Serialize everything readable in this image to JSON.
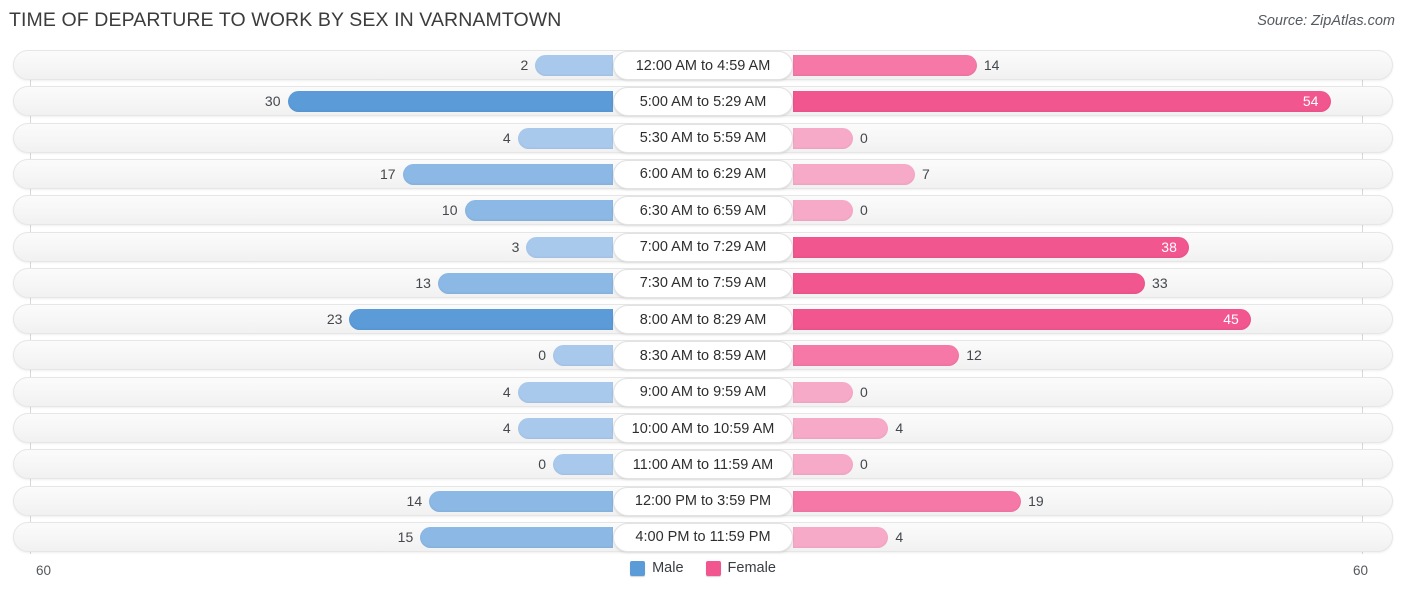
{
  "header": {
    "title": "TIME OF DEPARTURE TO WORK BY SEX IN VARNAMTOWN",
    "source": "Source: ZipAtlas.com"
  },
  "legend": {
    "items": [
      {
        "label": "Male",
        "color": "#5b9bd8"
      },
      {
        "label": "Female",
        "color": "#f1568e"
      }
    ]
  },
  "axis": {
    "left_tick": "60",
    "right_tick": "60"
  },
  "chart_data": {
    "type": "bar",
    "orientation": "horizontal-diverging",
    "title": "TIME OF DEPARTURE TO WORK BY SEX IN VARNAMTOWN",
    "xlabel": "",
    "ylabel": "",
    "xlim": [
      60,
      60
    ],
    "grid": false,
    "legend_position": "bottom-center",
    "categories": [
      "12:00 AM to 4:59 AM",
      "5:00 AM to 5:29 AM",
      "5:30 AM to 5:59 AM",
      "6:00 AM to 6:29 AM",
      "6:30 AM to 6:59 AM",
      "7:00 AM to 7:29 AM",
      "7:30 AM to 7:59 AM",
      "8:00 AM to 8:29 AM",
      "8:30 AM to 8:59 AM",
      "9:00 AM to 9:59 AM",
      "10:00 AM to 10:59 AM",
      "11:00 AM to 11:59 AM",
      "12:00 PM to 3:59 PM",
      "4:00 PM to 11:59 PM"
    ],
    "series": [
      {
        "name": "Male",
        "color": "#5b9bd8",
        "values": [
          2,
          30,
          4,
          17,
          10,
          3,
          13,
          23,
          0,
          4,
          4,
          0,
          14,
          15
        ]
      },
      {
        "name": "Female",
        "color": "#f1568e",
        "values": [
          14,
          54,
          0,
          7,
          0,
          38,
          33,
          45,
          12,
          0,
          4,
          0,
          19,
          4
        ]
      }
    ]
  },
  "rows": [
    {
      "label": "12:00 AM to 4:59 AM",
      "male": "2",
      "female": "14"
    },
    {
      "label": "5:00 AM to 5:29 AM",
      "male": "30",
      "female": "54"
    },
    {
      "label": "5:30 AM to 5:59 AM",
      "male": "4",
      "female": "0"
    },
    {
      "label": "6:00 AM to 6:29 AM",
      "male": "17",
      "female": "7"
    },
    {
      "label": "6:30 AM to 6:59 AM",
      "male": "10",
      "female": "0"
    },
    {
      "label": "7:00 AM to 7:29 AM",
      "male": "3",
      "female": "38"
    },
    {
      "label": "7:30 AM to 7:59 AM",
      "male": "13",
      "female": "33"
    },
    {
      "label": "8:00 AM to 8:29 AM",
      "male": "23",
      "female": "45"
    },
    {
      "label": "8:30 AM to 8:59 AM",
      "male": "0",
      "female": "12"
    },
    {
      "label": "9:00 AM to 9:59 AM",
      "male": "4",
      "female": "0"
    },
    {
      "label": "10:00 AM to 10:59 AM",
      "male": "4",
      "female": "4"
    },
    {
      "label": "11:00 AM to 11:59 AM",
      "male": "0",
      "female": "0"
    },
    {
      "label": "12:00 PM to 3:59 PM",
      "male": "14",
      "female": "19"
    },
    {
      "label": "4:00 PM to 11:59 PM",
      "male": "15",
      "female": "4"
    }
  ]
}
